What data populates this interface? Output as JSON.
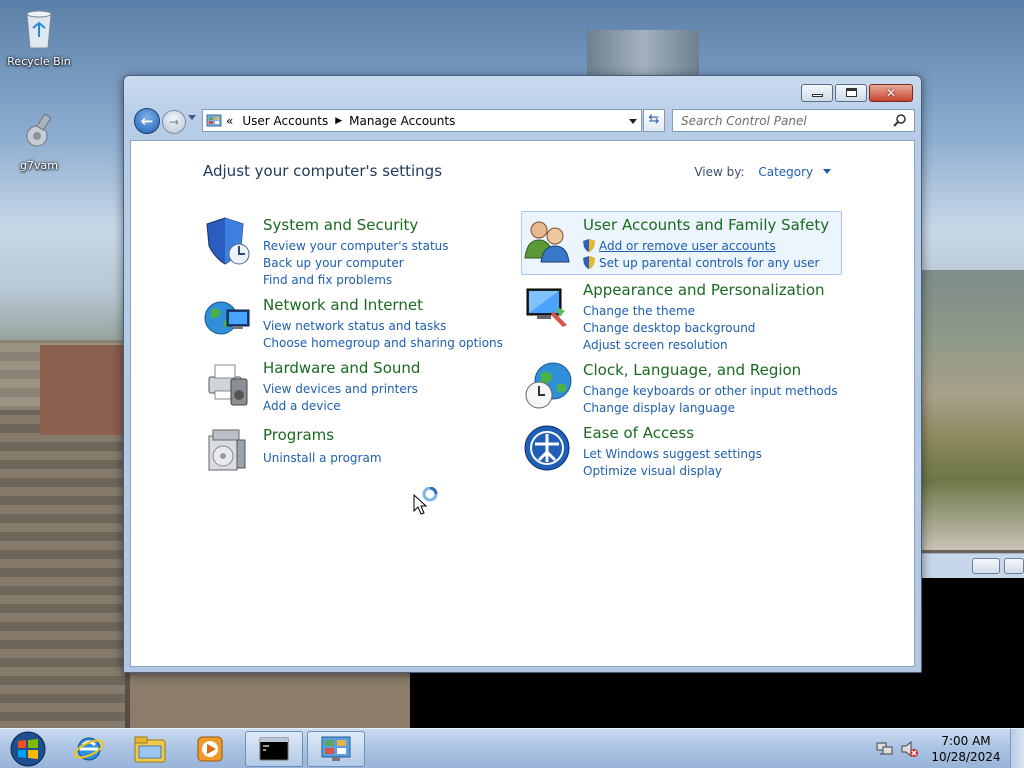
{
  "desktop": {
    "icons": [
      {
        "label": "Recycle Bin",
        "icon": "recycle-bin-icon"
      },
      {
        "label": "g7vam",
        "icon": "shortcut-icon"
      }
    ]
  },
  "window": {
    "breadcrumb": {
      "prefix": "«",
      "items": [
        "User Accounts",
        "Manage Accounts"
      ]
    },
    "search_placeholder": "Search Control Panel",
    "heading": "Adjust your computer's settings",
    "view_by_label": "View by:",
    "view_by_value": "Category",
    "categories": [
      {
        "title": "System and Security",
        "icon": "shield-icon",
        "links": [
          "Review your computer's status",
          "Back up your computer",
          "Find and fix problems"
        ]
      },
      {
        "title": "Network and Internet",
        "icon": "network-globe-icon",
        "links": [
          "View network status and tasks",
          "Choose homegroup and sharing options"
        ]
      },
      {
        "title": "Hardware and Sound",
        "icon": "printer-icon",
        "links": [
          "View devices and printers",
          "Add a device"
        ]
      },
      {
        "title": "Programs",
        "icon": "programs-icon",
        "links": [
          "Uninstall a program"
        ]
      },
      {
        "title": "User Accounts and Family Safety",
        "icon": "users-icon",
        "links": [
          "Add or remove user accounts",
          "Set up parental controls for any user"
        ]
      },
      {
        "title": "Appearance and Personalization",
        "icon": "monitor-paint-icon",
        "links": [
          "Change the theme",
          "Change desktop background",
          "Adjust screen resolution"
        ]
      },
      {
        "title": "Clock, Language, and Region",
        "icon": "clock-globe-icon",
        "links": [
          "Change keyboards or other input methods",
          "Change display language"
        ]
      },
      {
        "title": "Ease of Access",
        "icon": "ease-of-access-icon",
        "links": [
          "Let Windows suggest settings",
          "Optimize visual display"
        ]
      }
    ]
  },
  "taskbar": {
    "apps": [
      "start-orb",
      "internet-explorer-icon",
      "windows-explorer-icon",
      "media-player-icon",
      "command-prompt-icon",
      "control-panel-icon"
    ],
    "time": "7:00 AM",
    "date": "10/28/2024"
  },
  "colors": {
    "link": "#1e5fb0",
    "category_title": "#1a6a1f",
    "heading": "#1e395b"
  }
}
